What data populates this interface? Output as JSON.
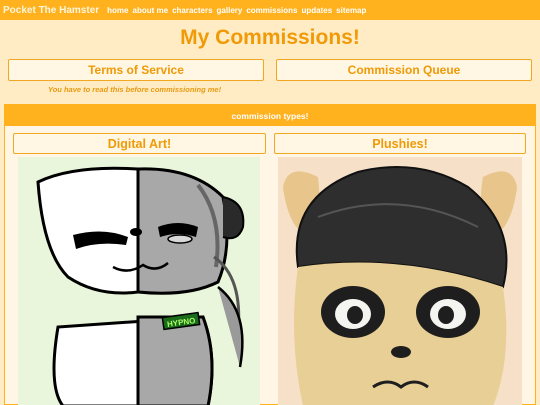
{
  "site": {
    "title": "Pocket The Hamster"
  },
  "nav": [
    "home",
    "about me",
    "characters",
    "gallery",
    "commissions",
    "updates",
    "sitemap"
  ],
  "page": {
    "title": "My Commissions!"
  },
  "buttons": {
    "tos": "Terms of Service",
    "queue": "Commission Queue"
  },
  "note": "You have to read this before commissioning me!",
  "section": {
    "header": "commission types!",
    "types": [
      {
        "label": "Digital Art!",
        "image_tag": "HYPNO"
      },
      {
        "label": "Plushies!"
      }
    ]
  },
  "colors": {
    "accent": "#ffb11e",
    "title": "#f19a07",
    "background": "#ffecc4"
  }
}
